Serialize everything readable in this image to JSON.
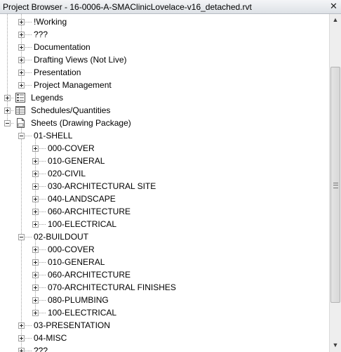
{
  "window": {
    "title": "Project Browser - 16-0006-A-SMAClinicLovelace-v16_detached.rvt",
    "close_glyph": "✕"
  },
  "tree": {
    "working": "!Working",
    "qqq": "???",
    "documentation": "Documentation",
    "drafting_views": "Drafting Views (Not Live)",
    "presentation": "Presentation",
    "project_management": "Project Management",
    "legends": "Legends",
    "schedules": "Schedules/Quantities",
    "sheets": "Sheets (Drawing Package)",
    "shell": {
      "label": "01-SHELL",
      "items": [
        "000-COVER",
        "010-GENERAL",
        "020-CIVIL",
        "030-ARCHITECTURAL SITE",
        "040-LANDSCAPE",
        "060-ARCHITECTURE",
        "100-ELECTRICAL"
      ]
    },
    "buildout": {
      "label": "02-BUILDOUT",
      "items": [
        "000-COVER",
        "010-GENERAL",
        "060-ARCHITECTURE",
        "070-ARCHITECTURAL FINISHES",
        "080-PLUMBING",
        "100-ELECTRICAL"
      ]
    },
    "presentation_sheets": "03-PRESENTATION",
    "misc": "04-MISC",
    "unknown": "???"
  },
  "scrollbar": {
    "up_glyph": "▲",
    "down_glyph": "▼"
  }
}
